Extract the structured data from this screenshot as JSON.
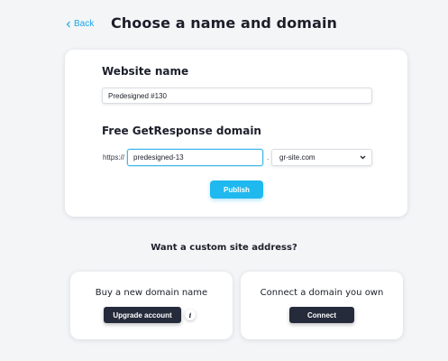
{
  "header": {
    "back_label": "Back",
    "title": "Choose a name and domain"
  },
  "website_name": {
    "label": "Website name",
    "value": "Predesigned #130"
  },
  "free_domain": {
    "label": "Free GetResponse domain",
    "prefix": "https://",
    "subdomain_value": "predesigned-13",
    "separator": ".",
    "domain_selected": "gr-site.com"
  },
  "publish_label": "Publish",
  "custom_address": {
    "title": "Want a custom site address?",
    "buy": {
      "heading": "Buy a new domain name",
      "button_label": "Upgrade account",
      "info_icon": "info-icon",
      "info_glyph": "i"
    },
    "connect": {
      "heading": "Connect a domain you own",
      "button_label": "Connect"
    }
  },
  "colors": {
    "accent": "#1fb8ef",
    "dark_button": "#252b3b",
    "background": "#f4f5f7"
  },
  "icons": [
    "chevron-left-icon",
    "chevron-down-icon",
    "info-icon"
  ]
}
